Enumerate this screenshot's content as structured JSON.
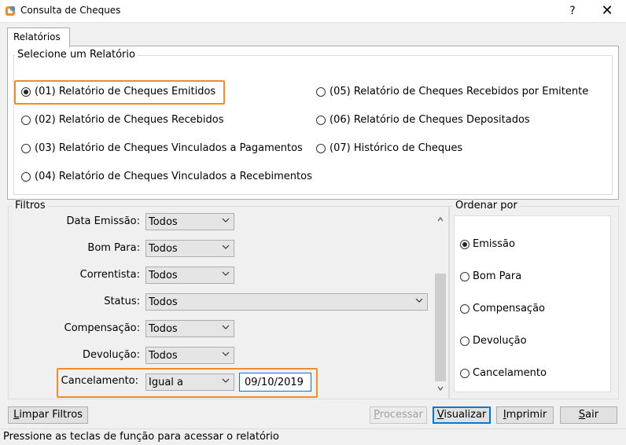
{
  "window": {
    "title": "Consulta de Cheques",
    "help": "?",
    "close": "✕"
  },
  "tab": {
    "label": "Relatórios"
  },
  "report_group": {
    "label": "Selecione um Relatório",
    "options": [
      {
        "label": "(01) Relatório de Cheques Emitidos",
        "selected": true
      },
      {
        "label": "(02) Relatório de Cheques Recebidos",
        "selected": false
      },
      {
        "label": "(03) Relatório de Cheques Vinculados a Pagamentos",
        "selected": false
      },
      {
        "label": "(04) Relatório de Cheques Vinculados a Recebimentos",
        "selected": false
      },
      {
        "label": "(05) Relatório de Cheques Recebidos por Emitente",
        "selected": false
      },
      {
        "label": "(06) Relatório de Cheques Depositados",
        "selected": false
      },
      {
        "label": "(07) Histórico de Cheques",
        "selected": false
      }
    ]
  },
  "filters": {
    "label": "Filtros",
    "rows": [
      {
        "label": "Data Emissão:",
        "value": "Todos"
      },
      {
        "label": "Bom Para:",
        "value": "Todos"
      },
      {
        "label": "Correntista:",
        "value": "Todos"
      },
      {
        "label": "Status:",
        "value": "Todos"
      },
      {
        "label": "Compensação:",
        "value": "Todos"
      },
      {
        "label": "Devolução:",
        "value": "Todos"
      },
      {
        "label": "Cancelamento:",
        "value": "Igual a",
        "date": "09/10/2019"
      }
    ]
  },
  "order": {
    "label": "Ordenar por",
    "options": [
      {
        "label": "Emissão",
        "selected": true
      },
      {
        "label": "Bom Para",
        "selected": false
      },
      {
        "label": "Compensação",
        "selected": false
      },
      {
        "label": "Devolução",
        "selected": false
      },
      {
        "label": "Cancelamento",
        "selected": false
      }
    ]
  },
  "buttons": {
    "clear_first": "L",
    "clear_rest": "impar Filtros",
    "process_first": "P",
    "process_rest": "rocessar",
    "view_first": "V",
    "view_rest": "isualizar",
    "print_first": "I",
    "print_rest": "mprimir",
    "exit_first": "S",
    "exit_rest": "air"
  },
  "status": "Pressione as teclas de função para acessar o relatório",
  "colors": {
    "highlight": "#f28c28",
    "focus": "#0078d7"
  }
}
